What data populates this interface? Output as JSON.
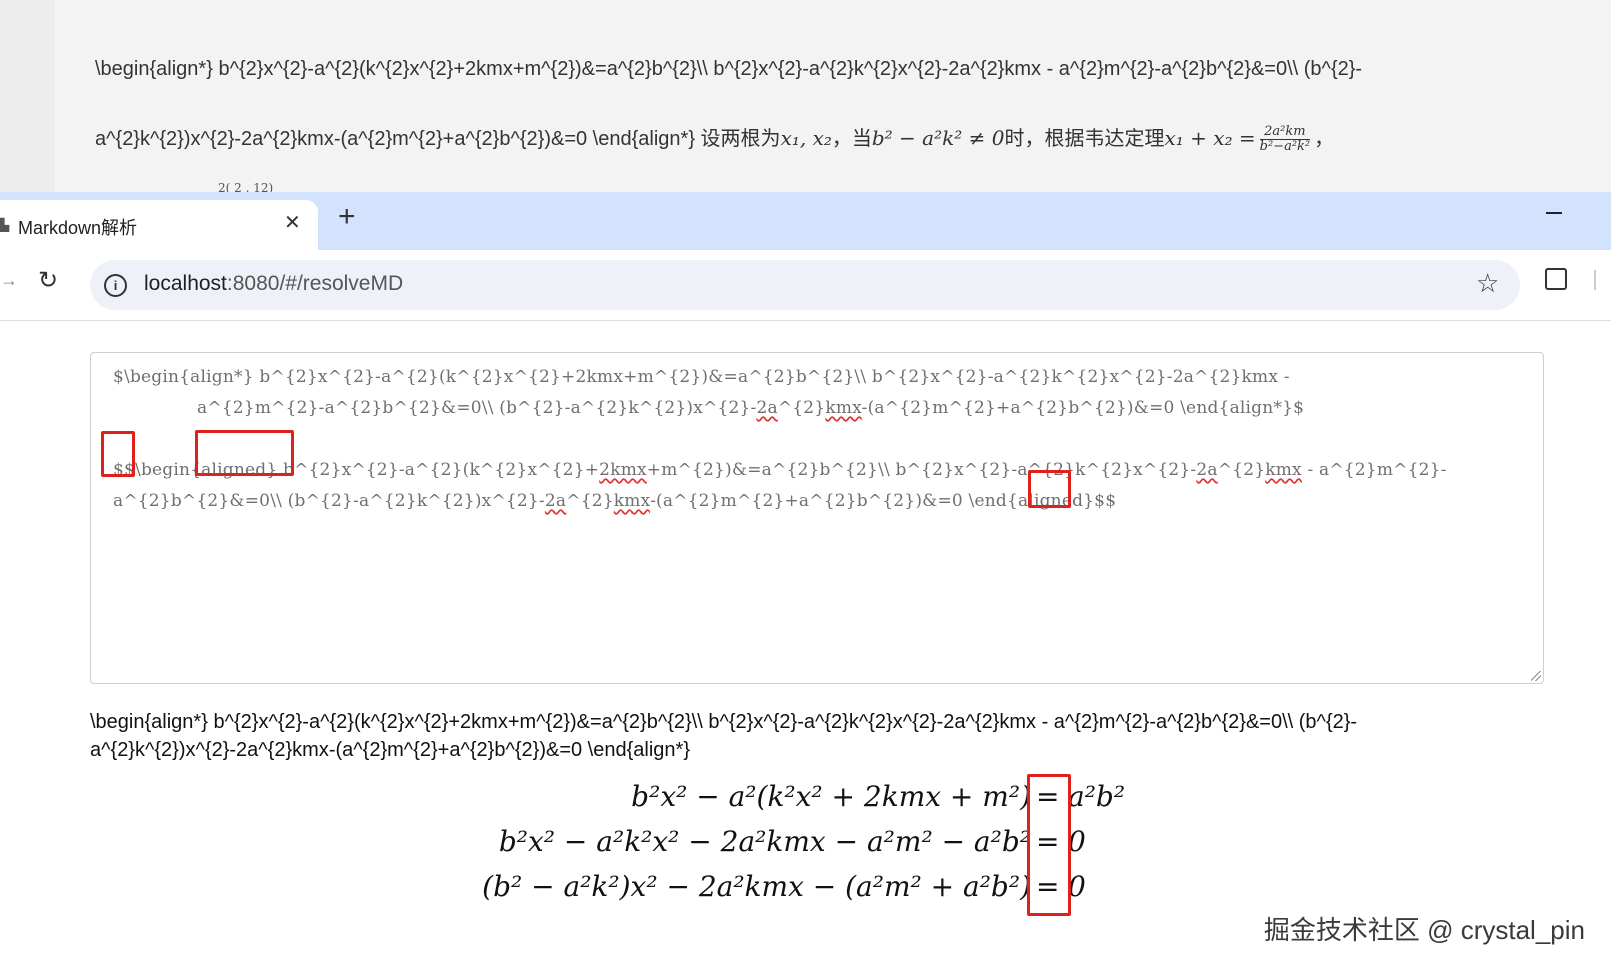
{
  "background_page": {
    "line1": "\\begin{align*} b^{2}x^{2}-a^{2}(k^{2}x^{2}+2kmx+m^{2})&=a^{2}b^{2}\\\\ b^{2}x^{2}-a^{2}k^{2}x^{2}-2a^{2}kmx - a^{2}m^{2}-a^{2}b^{2}&=0\\\\ (b^{2}-",
    "line2_prefix": "a^{2}k^{2})x^{2}-2a^{2}kmx-(a^{2}m^{2}+a^{2}b^{2})&=0 \\end{align*} 设两根为",
    "line2_roots": "x₁, x₂",
    "line2_when": "，当",
    "line2_condition": "b² − a²k² ≠ 0",
    "line2_vieta": "时，根据韦达定理",
    "line2_sum": "x₁ + x₂ =",
    "frac_num": "2a²km",
    "frac_den": "b²−a²k²",
    "line2_end": "，",
    "cut_fragment": "2(  2 . 12)"
  },
  "browser": {
    "tab_title": "Markdown解析",
    "tab_close": "✕",
    "new_tab": "+",
    "url_host": "localhost",
    "url_path": ":8080/#/resolveMD",
    "info": "i",
    "star": "☆",
    "reload": "↻",
    "forward": "→"
  },
  "editor": {
    "line1": "$\\begin{align*} b^{2}x^{2}-a^{2}(k^{2}x^{2}+2kmx+m^{2})&=a^{2}b^{2}\\\\ b^{2}x^{2}-a^{2}k^{2}x^{2}-2a^{2}kmx -",
    "line2_a": "a^{2}m^{2}-a^{2}b^{2}&=0\\\\ (b^{2}-a^{2}k^{2})x^{2}-",
    "line2_sq1": "2a",
    "line2_b": "^{2}",
    "line2_sq2": "kmx",
    "line2_c": "-(a^{2}m^{2}+a^{2}b^{2})&=0 \\end{align*}$",
    "line3_a": "$$\\begin{aligned} b^{2}x^{2}-a^{2}(k^{2}x^{2}+",
    "line3_sq1": "2kmx",
    "line3_b": "+m^{2})&=a^{2}b^{2}\\\\ b^{2}x^{2}-a^{2}k^{2}x^{2}-",
    "line3_sq2": "2a",
    "line3_c": "^{2}",
    "line3_sq3": "kmx",
    "line3_d": " - a^{2}m^{2}-",
    "line4_a": "a^{2}b^{2}&=0\\\\ (b^{2}-a^{2}k^{2})x^{2}-",
    "line4_sq1": "2a",
    "line4_b": "^{2}",
    "line4_sq2": "kmx",
    "line4_c": "-(a^{2}m^{2}+a^{2}b^{2})&=0 \\end{aligned}$$"
  },
  "preview": {
    "raw_text": "\\begin{align*} b^{2}x^{2}-a^{2}(k^{2}x^{2}+2kmx+m^{2})&=a^{2}b^{2}\\\\ b^{2}x^{2}-a^{2}k^{2}x^{2}-2a^{2}kmx - a^{2}m^{2}-a^{2}b^{2}&=0\\\\ (b^{2}-a^{2}k^{2})x^{2}-2a^{2}kmx-(a^{2}m^{2}+a^{2}b^{2})&=0 \\end{align*}",
    "eq_sign": "=",
    "row1_lhs": "b²x² − a²(k²x² + 2kmx + m²)",
    "row1_rhs": "a²b²",
    "row2_lhs": "b²x² − a²k²x² − 2a²kmx − a²m² − a²b²",
    "row2_rhs": "0",
    "row3_lhs": "(b² − a²k²)x² − 2a²kmx − (a²m² + a²b²)",
    "row3_rhs": "0"
  },
  "watermark": "掘金技术社区 @ crystal_pin",
  "colors": {
    "highlight_box": "#e0201a",
    "tabbar": "#d3e3fd",
    "omnibox": "#eef2f8"
  }
}
